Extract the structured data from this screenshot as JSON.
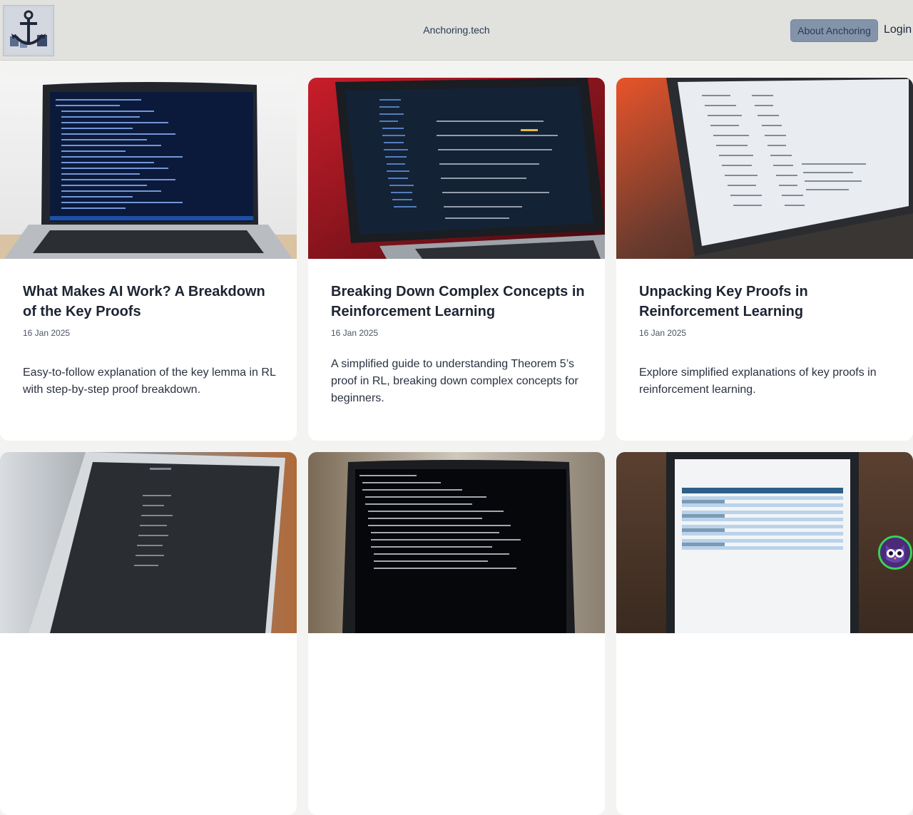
{
  "header": {
    "logo_icon": "anchor-logo-icon",
    "site_title": "Anchoring.tech",
    "about_label": "About Anchoring",
    "login_label": "Login"
  },
  "posts": [
    {
      "title": "What Makes AI Work? A Breakdown of the Key Proofs",
      "date": "16 Jan 2025",
      "description": "Easy-to-follow explanation of the key lemma in RL with step-by-step proof breakdown.",
      "image_icon": "laptop-code-dark-photo"
    },
    {
      "title": "Breaking Down Complex Concepts in Reinforcement Learning",
      "date": "16 Jan 2025",
      "description": "A simplified guide to understanding Theorem 5’s proof in RL, breaking down complex concepts for beginners.",
      "image_icon": "laptop-code-red-photo"
    },
    {
      "title": "Unpacking Key Proofs in Reinforcement Learning",
      "date": "16 Jan 2025",
      "description": "Explore simplified explanations of key proofs in reinforcement learning.",
      "image_icon": "laptop-spreadsheet-warm-photo"
    },
    {
      "image_icon": "laptop-light-doc-photo"
    },
    {
      "image_icon": "laptop-terminal-photo"
    },
    {
      "image_icon": "laptop-table-photo"
    }
  ],
  "avatar_icon": "owl-avatar-icon",
  "colors": {
    "header_bg": "#e1e2de",
    "about_button_bg": "#8393a9",
    "card_bg": "#ffffff",
    "page_bg": "#f3f3f1"
  }
}
